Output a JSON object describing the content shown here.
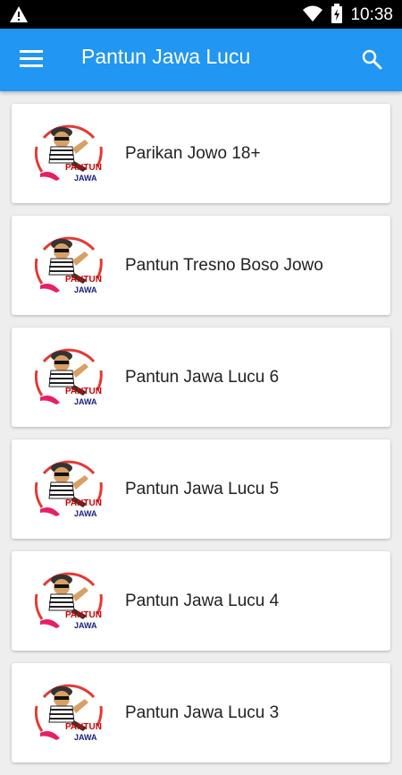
{
  "status_bar": {
    "time": "10:38",
    "icons": [
      "warning-icon",
      "wifi-icon",
      "battery-icon"
    ]
  },
  "app_bar": {
    "title": "Pantun Jawa Lucu",
    "menu_icon": "menu-icon",
    "search_icon": "search-icon",
    "color": "#2196F3"
  },
  "thumbnail": {
    "line1": "PANTUN",
    "line2": "JAWA"
  },
  "items": [
    {
      "label": "Parikan Jowo 18+"
    },
    {
      "label": "Pantun Tresno Boso Jowo"
    },
    {
      "label": "Pantun Jawa Lucu 6"
    },
    {
      "label": "Pantun Jawa Lucu 5"
    },
    {
      "label": "Pantun Jawa Lucu 4"
    },
    {
      "label": "Pantun Jawa Lucu 3"
    }
  ]
}
